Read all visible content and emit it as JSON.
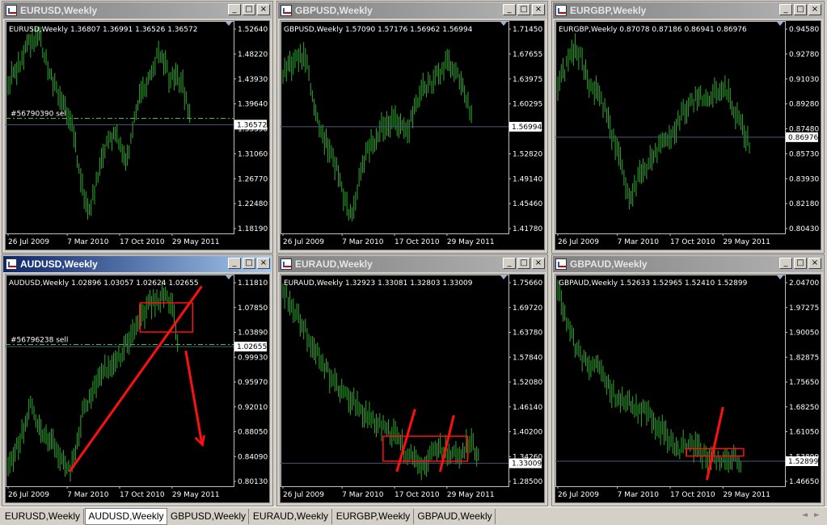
{
  "windows": [
    {
      "title": "EURUSD,Weekly",
      "active": false,
      "info": "EURUSD,Weekly  1.36807 1.36991 1.36526 1.36572",
      "prices": [
        "1.52640",
        "1.48220",
        "1.43930",
        "1.39640",
        "1.35350",
        "1.31060",
        "1.26770",
        "1.22480",
        "1.18190"
      ],
      "current": "1.36572",
      "order": "#56790390 sel",
      "dates": [
        "26 Jul 2009",
        "7 Mar 2010",
        "17 Oct 2010",
        "29 May 2011"
      ]
    },
    {
      "title": "GBPUSD,Weekly",
      "active": false,
      "info": "GBPUSD,Weekly  1.57090 1.57176 1.56962 1.56994",
      "prices": [
        "1.71450",
        "1.67655",
        "1.63975",
        "1.60295",
        "1.56994",
        "1.52820",
        "1.49140",
        "1.45460",
        "1.41780"
      ],
      "current": "1.56994",
      "order": "",
      "dates": [
        "26 Jul 2009",
        "7 Mar 2010",
        "17 Oct 2010",
        "29 May 2011"
      ]
    },
    {
      "title": "EURGBP,Weekly",
      "active": false,
      "info": "EURGBP,Weekly  0.87078 0.87186 0.86941 0.86976",
      "prices": [
        "0.94580",
        "0.92780",
        "0.91030",
        "0.89280",
        "0.87480",
        "0.85730",
        "0.83930",
        "0.82180",
        "0.80430"
      ],
      "current": "0.86976",
      "order": "",
      "dates": [
        "26 Jul 2009",
        "7 Mar 2010",
        "17 Oct 2010",
        "29 May 2011"
      ]
    },
    {
      "title": "AUDUSD,Weekly",
      "active": true,
      "info": "AUDUSD,Weekly  1.02896 1.03057 1.02624 1.02655",
      "prices": [
        "1.11810",
        "1.07850",
        "1.03890",
        "0.99930",
        "0.95970",
        "0.92010",
        "0.88050",
        "0.84090",
        "0.80130"
      ],
      "current": "1.02655",
      "order": "#56796238 sell",
      "dates": [
        "26 Jul 2009",
        "7 Mar 2010",
        "17 Oct 2010",
        "29 May 2011"
      ]
    },
    {
      "title": "EURAUD,Weekly",
      "active": false,
      "info": "EURAUD,Weekly  1.32923 1.33081 1.32803 1.33009",
      "prices": [
        "1.75660",
        "1.69720",
        "1.63780",
        "1.57840",
        "1.52080",
        "1.46140",
        "1.40200",
        "1.34260",
        "1.28500"
      ],
      "current": "1.33009",
      "order": "",
      "dates": [
        "26 Jul 2009",
        "7 Mar 2010",
        "17 Oct 2010",
        "29 May 2011"
      ]
    },
    {
      "title": "GBPAUD,Weekly",
      "active": false,
      "info": "GBPAUD,Weekly  1.52633 1.52965 1.52410 1.52899",
      "prices": [
        "2.04700",
        "1.97275",
        "1.90050",
        "1.82875",
        "1.75650",
        "1.68250",
        "1.61050",
        "1.53899",
        "1.46650"
      ],
      "current": "1.52899",
      "order": "",
      "dates": [
        "26 Jul 2009",
        "7 Mar 2010",
        "17 Oct 2010",
        "29 May 2011"
      ]
    }
  ],
  "tabs": [
    "EURUSD,Weekly",
    "AUDUSD,Weekly",
    "GBPUSD,Weekly",
    "EURAUD,Weekly",
    "EURGBP,Weekly",
    "GBPAUD,Weekly"
  ],
  "active_tab": "AUDUSD,Weekly",
  "buttons": {
    "minimize": "_",
    "maximize": "□",
    "close": "×"
  },
  "scroll": {
    "left": "◄",
    "right": "►"
  },
  "colors": {
    "bar": "#2eaa2e",
    "grid": "#4a5a7a",
    "order": "#32cd32",
    "annotation": "#ff1010",
    "active_title": "#0a246a"
  }
}
